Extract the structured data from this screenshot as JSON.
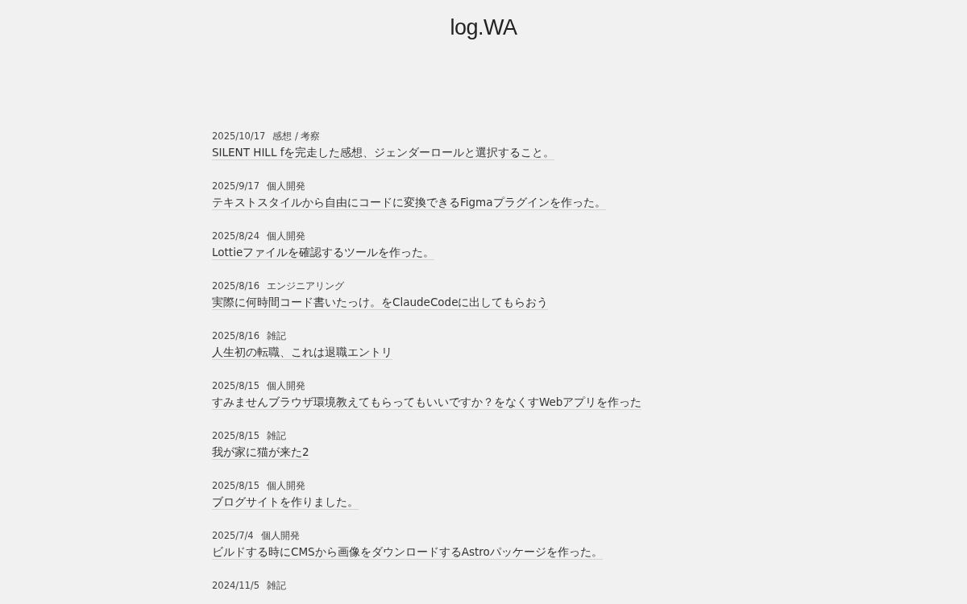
{
  "site": {
    "logo": "log.WA"
  },
  "posts": [
    {
      "date": "2025/10/17",
      "category": "感想 / 考察",
      "title": "SILENT HILL fを完走した感想、ジェンダーロールと選択すること。"
    },
    {
      "date": "2025/9/17",
      "category": "個人開発",
      "title": "テキストスタイルから自由にコードに変換できるFigmaプラグインを作った。"
    },
    {
      "date": "2025/8/24",
      "category": "個人開発",
      "title": "Lottieファイルを確認するツールを作った。"
    },
    {
      "date": "2025/8/16",
      "category": "エンジニアリング",
      "title": "実際に何時間コード書いたっけ。をClaudeCodeに出してもらおう"
    },
    {
      "date": "2025/8/16",
      "category": "雑記",
      "title": "人生初の転職、これは退職エントリ"
    },
    {
      "date": "2025/8/15",
      "category": "個人開発",
      "title": "すみませんブラウザ環境教えてもらってもいいですか？をなくすWebアプリを作った"
    },
    {
      "date": "2025/8/15",
      "category": "雑記",
      "title": "我が家に猫が来た2"
    },
    {
      "date": "2025/8/15",
      "category": "個人開発",
      "title": "ブログサイトを作りました。"
    },
    {
      "date": "2025/7/4",
      "category": "個人開発",
      "title": "ビルドする時にCMSから画像をダウンロードするAstroパッケージを作った。"
    },
    {
      "date": "2024/11/5",
      "category": "雑記"
    }
  ]
}
